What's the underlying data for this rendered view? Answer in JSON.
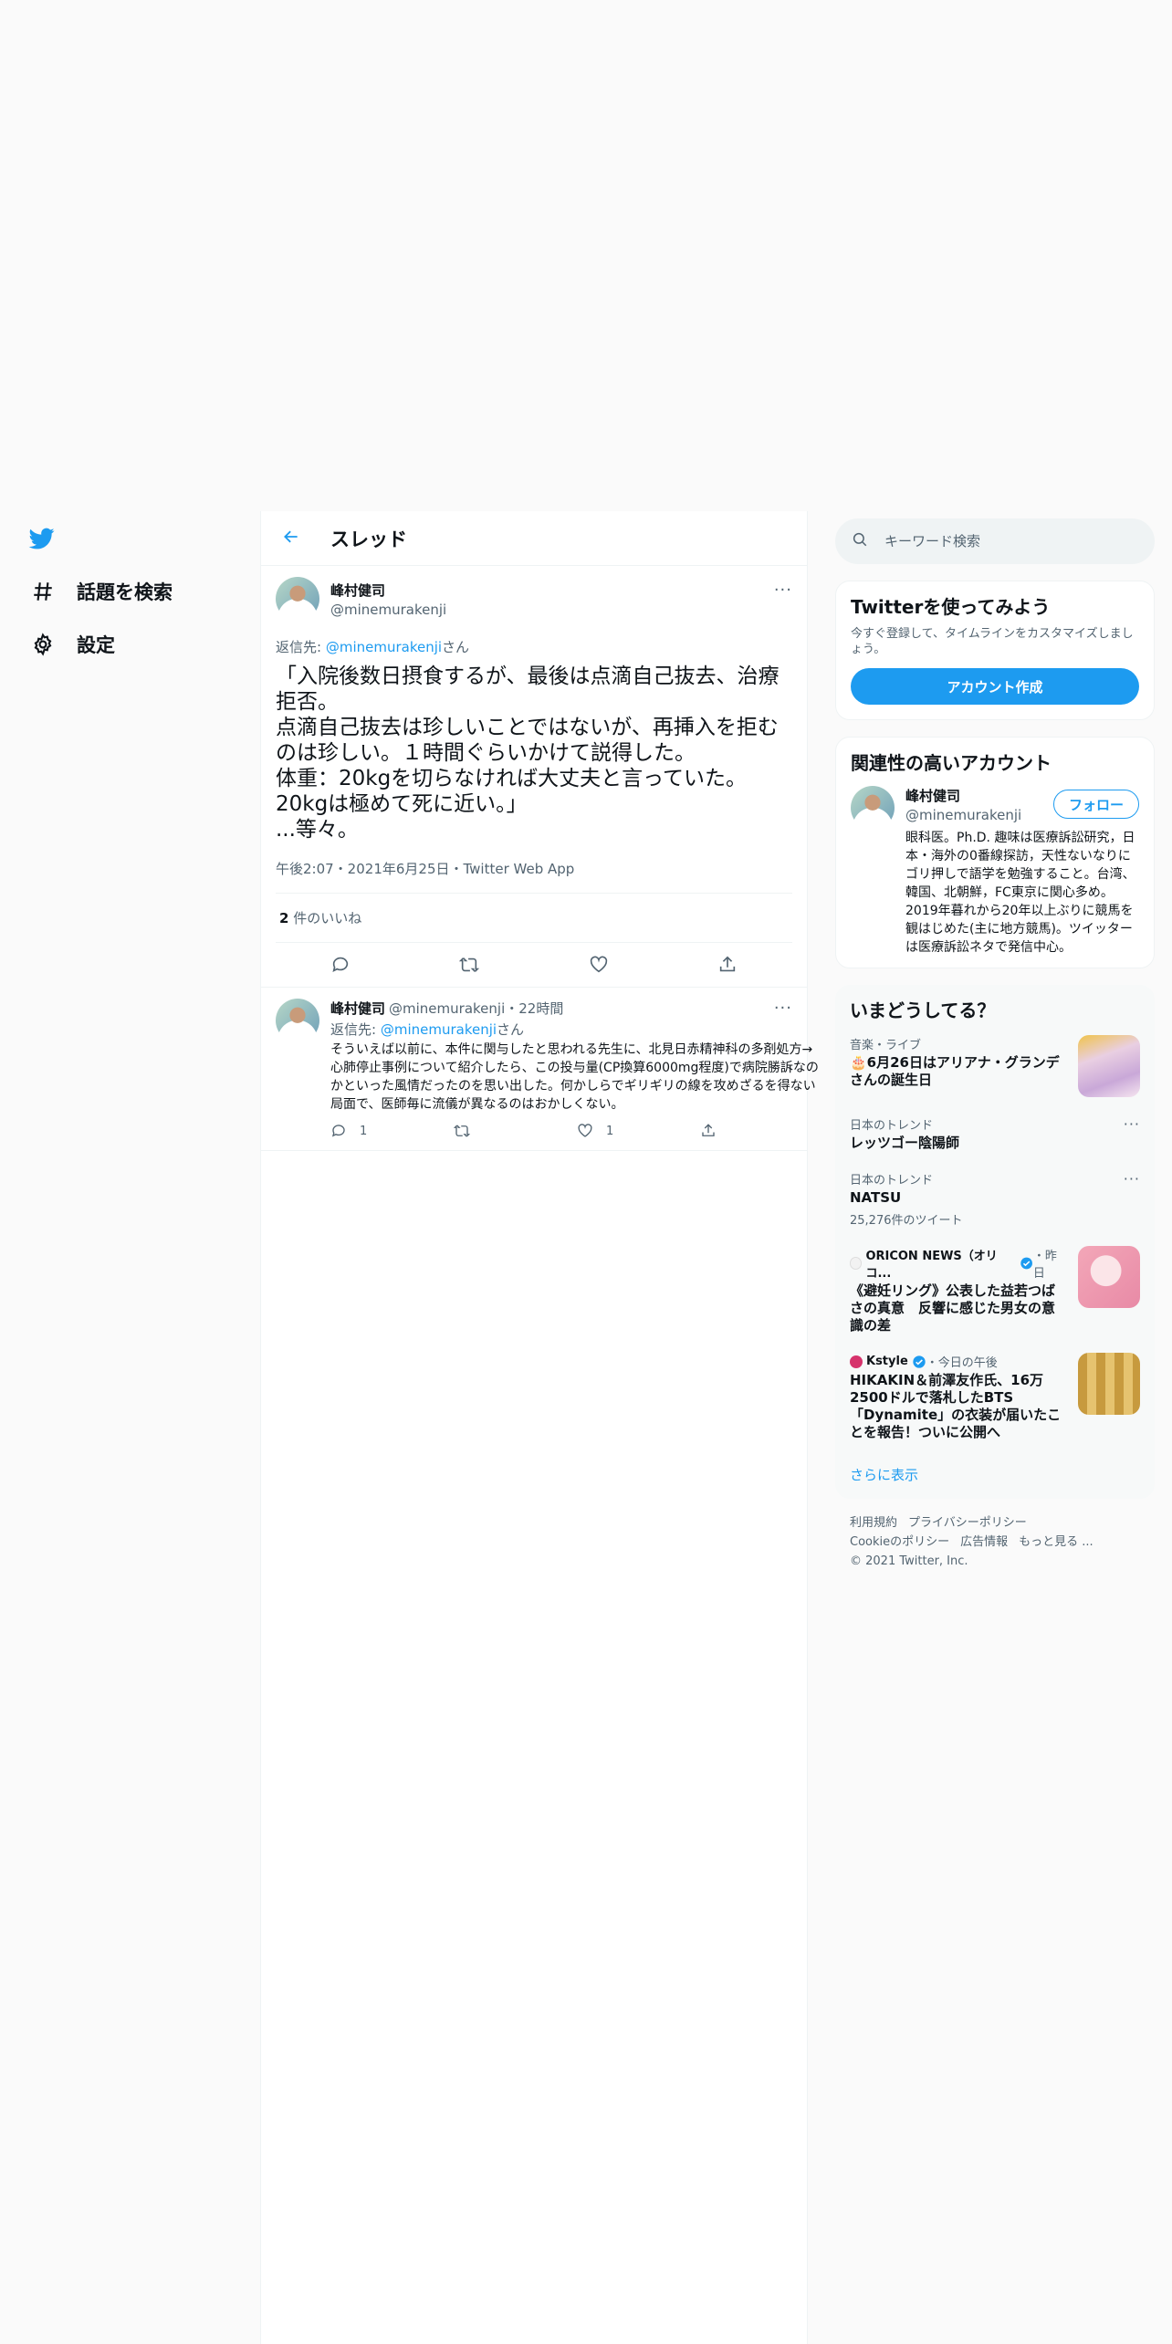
{
  "nav": {
    "explore_label": "話題を検索",
    "settings_label": "設定"
  },
  "thread": {
    "title": "スレッド",
    "main": {
      "name": "峰村健司",
      "handle": "@minemurakenji",
      "reply_prefix": "返信先: ",
      "reply_handle": "@minemurakenji",
      "reply_suffix": "さん",
      "text": "「入院後数日摂食するが、最後は点滴自己抜去、治療拒否。\n点滴自己抜去は珍しいことではないが、再挿入を拒むのは珍しい。１時間ぐらいかけて説得した。\n体重：20kgを切らなければ大丈夫と言っていた。\n20kgは極めて死に近い。」\n...等々。",
      "meta": "午後2:07・2021年6月25日・Twitter Web App",
      "likes_count": "2",
      "likes_label": " 件のいいね"
    },
    "reply": {
      "name": "峰村健司",
      "handle_time": "@minemurakenji・22時間",
      "reply_prefix": "返信先: ",
      "reply_handle": "@minemurakenji",
      "reply_suffix": "さん",
      "text": "そういえば以前に、本件に関与したと思われる先生に、北見日赤精神科の多剤処方→心肺停止事例について紹介したら、この投与量(CP換算6000mg程度)で病院勝訴なのかといった風情だったのを思い出した。何かしらでギリギリの線を攻めざるを得ない局面で、医師毎に流儀が異なるのはおかしくない。",
      "reply_count": "1",
      "like_count": "1"
    }
  },
  "sidebar": {
    "search_placeholder": "キーワード検索",
    "signup": {
      "title": "Twitterを使ってみよう",
      "subtitle": "今すぐ登録して、タイムラインをカスタマイズしましょう。",
      "button": "アカウント作成"
    },
    "relevant": {
      "title": "関連性の高いアカウント",
      "name": "峰村健司",
      "handle": "@minemurakenji",
      "follow": "フォロー",
      "bio": "眼科医。Ph.D. 趣味は医療訴訟研究，日本・海外の0番線探訪，天性ないなりにゴリ押しで語学を勉強すること。台湾、韓国、北朝鮮，FC東京に関心多め。2019年暮れから20年以上ぶりに競馬を観はじめた(主に地方競馬)。ツイッターは医療訴訟ネタで発信中心。"
    },
    "trends": {
      "title": "いまどうしてる？",
      "items": [
        {
          "category": "音楽・ライブ",
          "title": "🎂6月26日はアリアナ・グランデさんの誕生日"
        },
        {
          "category": "日本のトレンド",
          "title": "レッツゴー陰陽師"
        },
        {
          "category": "日本のトレンド",
          "title": "NATSU",
          "count": "25,276件のツイート"
        },
        {
          "source": "ORICON NEWS（オリコ...",
          "time": "・昨日",
          "title": "《避妊リング》公表した益若つばさの真意　反響に感じた男女の意識の差"
        },
        {
          "source": "Kstyle",
          "time": "・今日の午後",
          "title": "HIKAKIN＆前澤友作氏、16万2500ドルで落札したBTS「Dynamite」の衣装が届いたことを報告！ついに公開へ"
        }
      ],
      "show_more": "さらに表示"
    },
    "footer": {
      "terms": "利用規約",
      "privacy": "プライバシーポリシー",
      "cookie": "Cookieのポリシー",
      "ads": "広告情報",
      "more": "もっと見る ...",
      "copyright": "© 2021 Twitter, Inc."
    }
  },
  "colors": {
    "accent": "#1d9bf0",
    "text": "#0f1419",
    "muted": "#536471"
  },
  "icons": [
    "twitter-logo-icon",
    "hashtag-icon",
    "gear-icon",
    "back-arrow-icon",
    "more-icon",
    "reply-icon",
    "retweet-icon",
    "like-icon",
    "share-icon",
    "search-icon",
    "verified-icon"
  ]
}
